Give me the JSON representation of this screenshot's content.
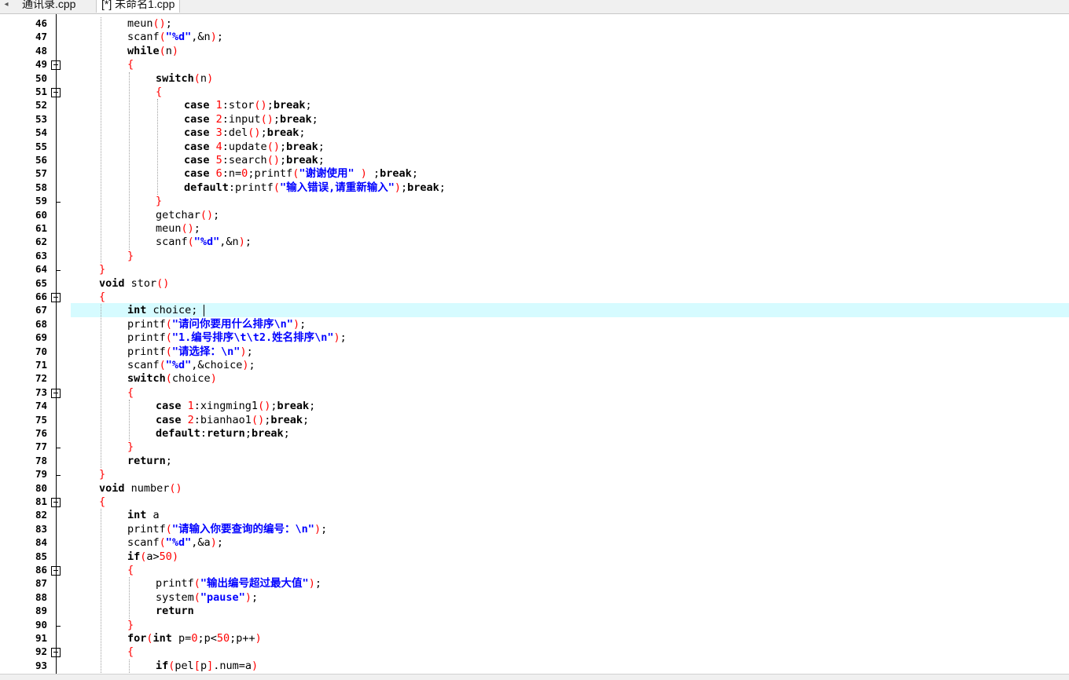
{
  "tabs": {
    "scroll_arrow": "◂",
    "items": [
      {
        "label": "通讯录.cpp"
      },
      {
        "label": "[*] 未命名1.cpp"
      }
    ]
  },
  "editor": {
    "highlight_line": 67,
    "lines": [
      {
        "n": "46",
        "indent": 2,
        "t": [
          [
            "meun",
            "f"
          ],
          [
            "()",
            "p"
          ],
          [
            ";",
            ""
          ]
        ]
      },
      {
        "n": "47",
        "indent": 2,
        "t": [
          [
            "scanf",
            ""
          ],
          [
            "(",
            "p"
          ],
          [
            "\"%d\"",
            "s"
          ],
          [
            ",&n",
            ""
          ],
          [
            ")",
            "p"
          ],
          [
            ";",
            ""
          ]
        ]
      },
      {
        "n": "48",
        "indent": 2,
        "t": [
          [
            "while",
            "k"
          ],
          [
            "(",
            "p"
          ],
          [
            "n",
            ""
          ],
          [
            ")",
            "p"
          ]
        ]
      },
      {
        "n": "49",
        "indent": 2,
        "t": [
          [
            "{",
            "p"
          ]
        ]
      },
      {
        "n": "50",
        "indent": 3,
        "t": [
          [
            "switch",
            "k"
          ],
          [
            "(",
            "p"
          ],
          [
            "n",
            ""
          ],
          [
            ")",
            "p"
          ]
        ]
      },
      {
        "n": "51",
        "indent": 3,
        "t": [
          [
            "{",
            "p"
          ]
        ]
      },
      {
        "n": "52",
        "indent": 4,
        "t": [
          [
            "case ",
            "k"
          ],
          [
            "1",
            "n"
          ],
          [
            ":stor",
            ""
          ],
          [
            "()",
            "p"
          ],
          [
            ";",
            ""
          ],
          [
            "break",
            "k"
          ],
          [
            ";",
            ""
          ]
        ]
      },
      {
        "n": "53",
        "indent": 4,
        "t": [
          [
            "case ",
            "k"
          ],
          [
            "2",
            "n"
          ],
          [
            ":input",
            ""
          ],
          [
            "()",
            "p"
          ],
          [
            ";",
            ""
          ],
          [
            "break",
            "k"
          ],
          [
            ";",
            ""
          ]
        ]
      },
      {
        "n": "54",
        "indent": 4,
        "t": [
          [
            "case ",
            "k"
          ],
          [
            "3",
            "n"
          ],
          [
            ":del",
            ""
          ],
          [
            "()",
            "p"
          ],
          [
            ";",
            ""
          ],
          [
            "break",
            "k"
          ],
          [
            ";",
            ""
          ]
        ]
      },
      {
        "n": "55",
        "indent": 4,
        "t": [
          [
            "case ",
            "k"
          ],
          [
            "4",
            "n"
          ],
          [
            ":update",
            ""
          ],
          [
            "()",
            "p"
          ],
          [
            ";",
            ""
          ],
          [
            "break",
            "k"
          ],
          [
            ";",
            ""
          ]
        ]
      },
      {
        "n": "56",
        "indent": 4,
        "t": [
          [
            "case ",
            "k"
          ],
          [
            "5",
            "n"
          ],
          [
            ":search",
            ""
          ],
          [
            "()",
            "p"
          ],
          [
            ";",
            ""
          ],
          [
            "break",
            "k"
          ],
          [
            ";",
            ""
          ]
        ]
      },
      {
        "n": "57",
        "indent": 4,
        "t": [
          [
            "case ",
            "k"
          ],
          [
            "6",
            "n"
          ],
          [
            ":n=",
            ""
          ],
          [
            "0",
            "n"
          ],
          [
            ";printf",
            ""
          ],
          [
            "(",
            "p"
          ],
          [
            "\"谢谢使用\"",
            "s"
          ],
          [
            " ",
            ""
          ],
          [
            ")",
            "p"
          ],
          [
            " ;",
            ""
          ],
          [
            "break",
            "k"
          ],
          [
            ";",
            ""
          ]
        ]
      },
      {
        "n": "58",
        "indent": 4,
        "t": [
          [
            "default",
            "k"
          ],
          [
            ":printf",
            ""
          ],
          [
            "(",
            "p"
          ],
          [
            "\"输入错误,请重新输入\"",
            "s"
          ],
          [
            ")",
            "p"
          ],
          [
            ";",
            ""
          ],
          [
            "break",
            "k"
          ],
          [
            ";",
            ""
          ]
        ]
      },
      {
        "n": "59",
        "indent": 3,
        "t": [
          [
            "}",
            "p"
          ]
        ]
      },
      {
        "n": "60",
        "indent": 3,
        "t": [
          [
            "getchar",
            ""
          ],
          [
            "()",
            "p"
          ],
          [
            ";",
            ""
          ]
        ]
      },
      {
        "n": "61",
        "indent": 3,
        "t": [
          [
            "meun",
            ""
          ],
          [
            "()",
            "p"
          ],
          [
            ";",
            ""
          ]
        ]
      },
      {
        "n": "62",
        "indent": 3,
        "t": [
          [
            "scanf",
            ""
          ],
          [
            "(",
            "p"
          ],
          [
            "\"%d\"",
            "s"
          ],
          [
            ",&n",
            ""
          ],
          [
            ")",
            "p"
          ],
          [
            ";",
            ""
          ]
        ]
      },
      {
        "n": "63",
        "indent": 2,
        "t": [
          [
            "}",
            "p"
          ]
        ]
      },
      {
        "n": "64",
        "indent": 1,
        "t": [
          [
            "}",
            "p"
          ]
        ]
      },
      {
        "n": "65",
        "indent": 1,
        "t": [
          [
            "void ",
            "k"
          ],
          [
            "stor",
            ""
          ],
          [
            "()",
            "p"
          ]
        ]
      },
      {
        "n": "66",
        "indent": 1,
        "t": [
          [
            "{",
            "p"
          ]
        ]
      },
      {
        "n": "67",
        "indent": 2,
        "t": [
          [
            "int ",
            "k"
          ],
          [
            "choice;",
            ""
          ]
        ]
      },
      {
        "n": "68",
        "indent": 2,
        "t": [
          [
            "printf",
            ""
          ],
          [
            "(",
            "p"
          ],
          [
            "\"请问你要用什么排序\\n\"",
            "s"
          ],
          [
            ")",
            "p"
          ],
          [
            ";",
            ""
          ]
        ]
      },
      {
        "n": "69",
        "indent": 2,
        "t": [
          [
            "printf",
            ""
          ],
          [
            "(",
            "p"
          ],
          [
            "\"1.编号排序\\t\\t2.姓名排序\\n\"",
            "s"
          ],
          [
            ")",
            "p"
          ],
          [
            ";",
            ""
          ]
        ]
      },
      {
        "n": "70",
        "indent": 2,
        "t": [
          [
            "printf",
            ""
          ],
          [
            "(",
            "p"
          ],
          [
            "\"请选择：\\n\"",
            "s"
          ],
          [
            ")",
            "p"
          ],
          [
            ";",
            ""
          ]
        ]
      },
      {
        "n": "71",
        "indent": 2,
        "t": [
          [
            "scanf",
            ""
          ],
          [
            "(",
            "p"
          ],
          [
            "\"%d\"",
            "s"
          ],
          [
            ",&choice",
            ""
          ],
          [
            ")",
            "p"
          ],
          [
            ";",
            ""
          ]
        ]
      },
      {
        "n": "72",
        "indent": 2,
        "t": [
          [
            "switch",
            "k"
          ],
          [
            "(",
            "p"
          ],
          [
            "choice",
            ""
          ],
          [
            ")",
            "p"
          ]
        ]
      },
      {
        "n": "73",
        "indent": 2,
        "t": [
          [
            "{",
            "p"
          ]
        ]
      },
      {
        "n": "74",
        "indent": 3,
        "t": [
          [
            "case ",
            "k"
          ],
          [
            "1",
            "n"
          ],
          [
            ":xingming1",
            ""
          ],
          [
            "()",
            "p"
          ],
          [
            ";",
            ""
          ],
          [
            "break",
            "k"
          ],
          [
            ";",
            ""
          ]
        ]
      },
      {
        "n": "75",
        "indent": 3,
        "t": [
          [
            "case ",
            "k"
          ],
          [
            "2",
            "n"
          ],
          [
            ":bianhao1",
            ""
          ],
          [
            "()",
            "p"
          ],
          [
            ";",
            ""
          ],
          [
            "break",
            "k"
          ],
          [
            ";",
            ""
          ]
        ]
      },
      {
        "n": "76",
        "indent": 3,
        "t": [
          [
            "default",
            "k"
          ],
          [
            ":",
            ""
          ],
          [
            "return",
            "k"
          ],
          [
            ";",
            ""
          ],
          [
            "break",
            "k"
          ],
          [
            ";",
            ""
          ]
        ]
      },
      {
        "n": "77",
        "indent": 2,
        "t": [
          [
            "}",
            "p"
          ]
        ]
      },
      {
        "n": "78",
        "indent": 2,
        "t": [
          [
            "return",
            "k"
          ],
          [
            ";",
            ""
          ]
        ]
      },
      {
        "n": "79",
        "indent": 1,
        "t": [
          [
            "}",
            "p"
          ]
        ]
      },
      {
        "n": "80",
        "indent": 1,
        "t": [
          [
            "void ",
            "k"
          ],
          [
            "number",
            ""
          ],
          [
            "()",
            "p"
          ]
        ]
      },
      {
        "n": "81",
        "indent": 1,
        "t": [
          [
            "{",
            "p"
          ]
        ]
      },
      {
        "n": "82",
        "indent": 2,
        "t": [
          [
            "int ",
            "k"
          ],
          [
            "a",
            ""
          ]
        ]
      },
      {
        "n": "83",
        "indent": 2,
        "t": [
          [
            "printf",
            ""
          ],
          [
            "(",
            "p"
          ],
          [
            "\"请输入你要查询的编号：\\n\"",
            "s"
          ],
          [
            ")",
            "p"
          ],
          [
            ";",
            ""
          ]
        ]
      },
      {
        "n": "84",
        "indent": 2,
        "t": [
          [
            "scanf",
            ""
          ],
          [
            "(",
            "p"
          ],
          [
            "\"%d\"",
            "s"
          ],
          [
            ",&a",
            ""
          ],
          [
            ")",
            "p"
          ],
          [
            ";",
            ""
          ]
        ]
      },
      {
        "n": "85",
        "indent": 2,
        "t": [
          [
            "if",
            "k"
          ],
          [
            "(",
            "p"
          ],
          [
            "a>",
            ""
          ],
          [
            "50",
            "n"
          ],
          [
            ")",
            "p"
          ]
        ]
      },
      {
        "n": "86",
        "indent": 2,
        "t": [
          [
            "{",
            "p"
          ]
        ]
      },
      {
        "n": "87",
        "indent": 3,
        "t": [
          [
            "printf",
            ""
          ],
          [
            "(",
            "p"
          ],
          [
            "\"输出编号超过最大值\"",
            "s"
          ],
          [
            ")",
            "p"
          ],
          [
            ";",
            ""
          ]
        ]
      },
      {
        "n": "88",
        "indent": 3,
        "t": [
          [
            "system",
            ""
          ],
          [
            "(",
            "p"
          ],
          [
            "\"pause\"",
            "s"
          ],
          [
            ")",
            "p"
          ],
          [
            ";",
            ""
          ]
        ]
      },
      {
        "n": "89",
        "indent": 3,
        "t": [
          [
            "return",
            "k"
          ]
        ]
      },
      {
        "n": "90",
        "indent": 2,
        "t": [
          [
            "}",
            "p"
          ]
        ]
      },
      {
        "n": "91",
        "indent": 2,
        "t": [
          [
            "for",
            "k"
          ],
          [
            "(",
            "p"
          ],
          [
            "int ",
            "k"
          ],
          [
            "p=",
            ""
          ],
          [
            "0",
            "n"
          ],
          [
            ";p<",
            ""
          ],
          [
            "50",
            "n"
          ],
          [
            ";p++",
            ""
          ],
          [
            ")",
            "p"
          ]
        ]
      },
      {
        "n": "92",
        "indent": 2,
        "t": [
          [
            "{",
            "p"
          ]
        ]
      },
      {
        "n": "93",
        "indent": 3,
        "t": [
          [
            "if",
            "k"
          ],
          [
            "(",
            "p"
          ],
          [
            "pel",
            ""
          ],
          [
            "[",
            "p"
          ],
          [
            "p",
            ""
          ],
          [
            "]",
            "p"
          ],
          [
            ".num=a",
            ""
          ],
          [
            ")",
            "p"
          ]
        ]
      }
    ]
  }
}
